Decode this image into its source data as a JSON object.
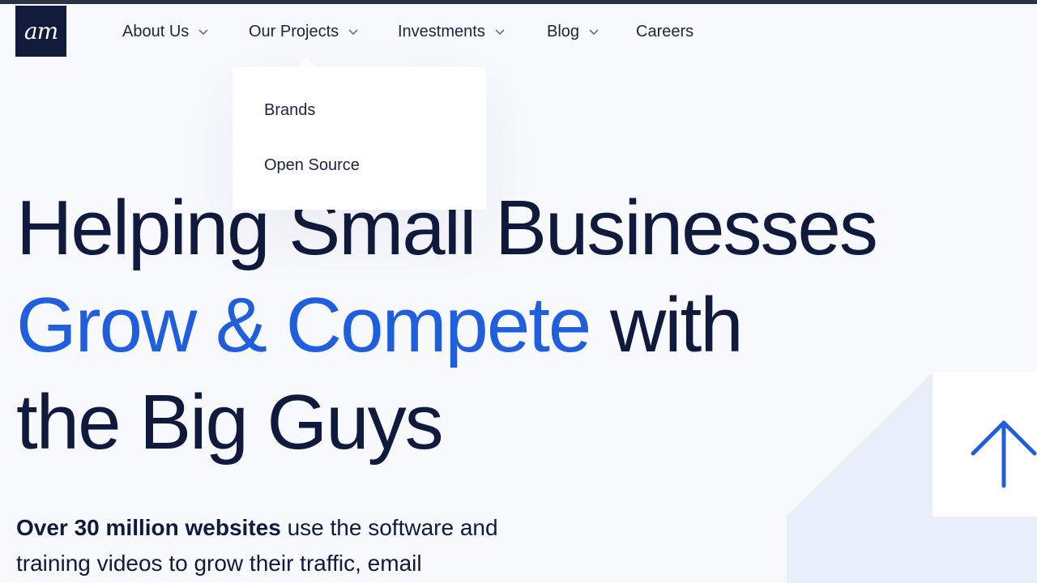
{
  "logo": {
    "text": "am"
  },
  "nav": {
    "items": [
      {
        "label": "About Us",
        "has_dropdown": true
      },
      {
        "label": "Our Projects",
        "has_dropdown": true
      },
      {
        "label": "Investments",
        "has_dropdown": true
      },
      {
        "label": "Blog",
        "has_dropdown": true
      },
      {
        "label": "Careers",
        "has_dropdown": false
      }
    ],
    "icons": {
      "dropdown": "chevron-down-icon"
    }
  },
  "dropdown": {
    "parent": "Our Projects",
    "items": [
      {
        "label": "Brands"
      },
      {
        "label": "Open Source"
      }
    ]
  },
  "hero": {
    "line1": "Helping Small Businesses",
    "line2_accent": "Grow & Compete",
    "line2_rest": " with",
    "line3": "the Big Guys"
  },
  "subcopy": {
    "bold": "Over 30 million websites",
    "line1_rest": " use the software and",
    "line2": "training videos to grow their traffic, email"
  },
  "scroll_top": {
    "icon": "arrow-up-icon"
  },
  "colors": {
    "navy": "#101a3c",
    "accent": "#1f5fdd",
    "background": "#f8f9fd",
    "top_bar": "#2b3340",
    "decor": "#e8effa"
  }
}
